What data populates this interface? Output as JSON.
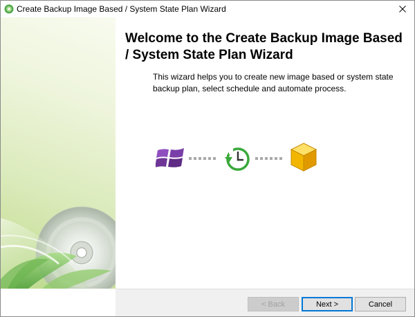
{
  "window": {
    "title": "Create Backup Image Based / System State Plan Wizard",
    "app_icon": "green-disc-icon",
    "close_icon": "close-icon"
  },
  "content": {
    "heading": "Welcome to the Create Backup Image Based / System State Plan Wizard",
    "description": "This wizard helps you to create new image based or system state backup plan, select schedule and automate process."
  },
  "illustration": {
    "icons": [
      "windows-icon",
      "schedule-clock-icon",
      "storage-cube-icon"
    ],
    "colors": {
      "windows": "#7a3ea8",
      "clock": "#3aa83a",
      "cube": "#f2b600"
    }
  },
  "footer": {
    "back_label": "< Back",
    "next_label": "Next >",
    "cancel_label": "Cancel"
  }
}
